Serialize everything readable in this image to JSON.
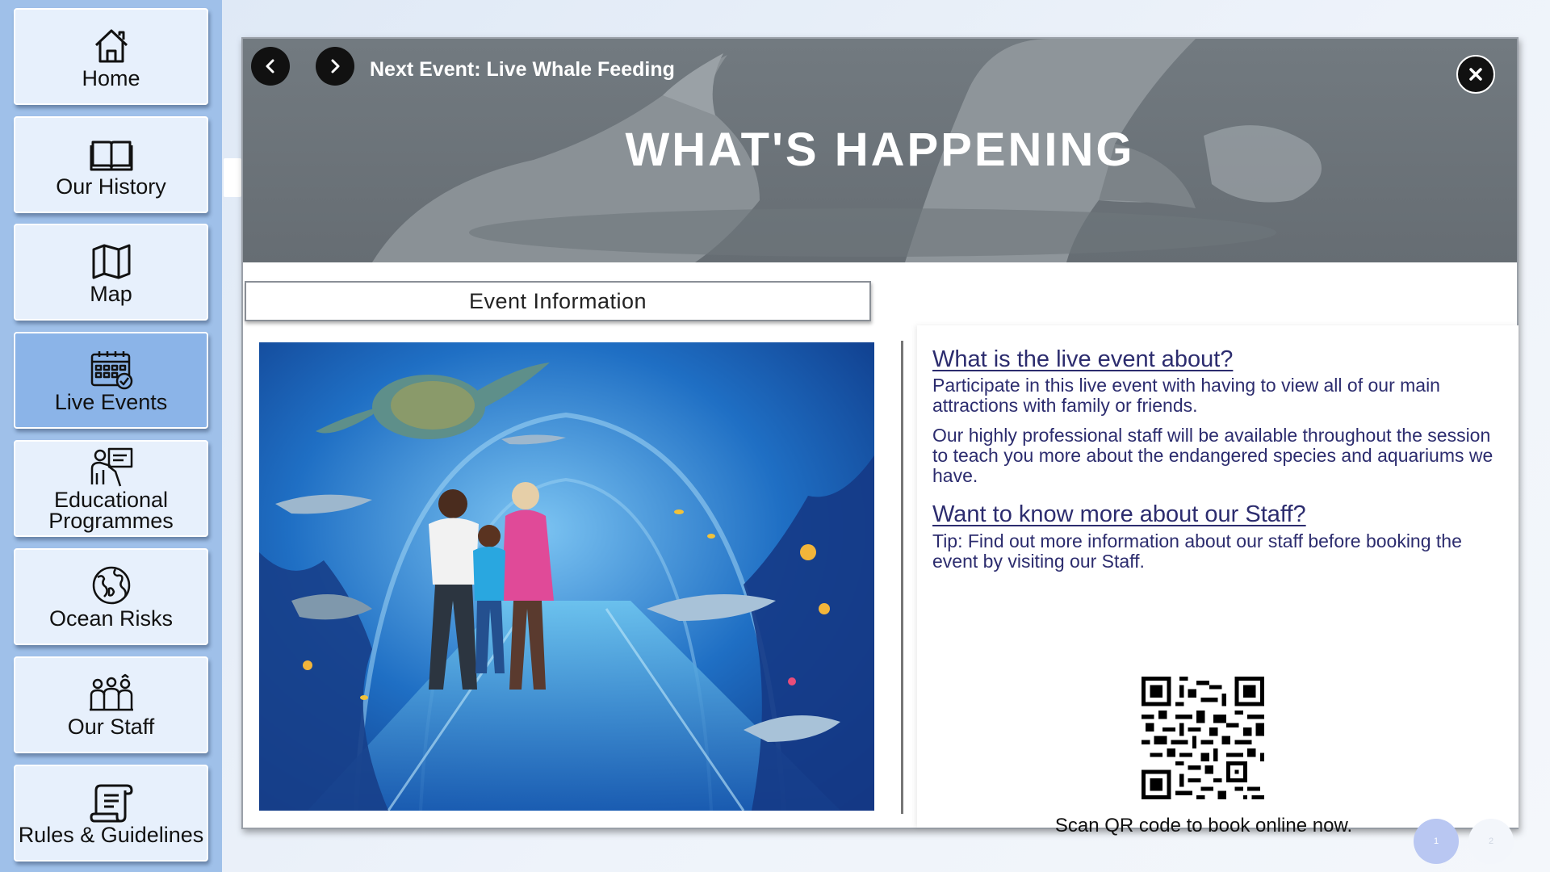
{
  "sidebar": {
    "items": [
      {
        "label": "Home",
        "icon": "home-icon"
      },
      {
        "label": "Our History",
        "icon": "book-icon"
      },
      {
        "label": "Map",
        "icon": "map-icon"
      },
      {
        "label": "Live Events",
        "icon": "calendar-check-icon",
        "active": true
      },
      {
        "label": "Educational Programmes",
        "icon": "teacher-board-icon"
      },
      {
        "label": "Ocean Risks",
        "icon": "globe-icon"
      },
      {
        "label": "Our Staff",
        "icon": "staff-group-icon"
      },
      {
        "label": "Rules & Guidelines",
        "icon": "scroll-icon"
      }
    ]
  },
  "banner": {
    "next_event": "Next Event: Live Whale Feeding",
    "title": "WHAT'S HAPPENING"
  },
  "tab": {
    "label": "Event Information"
  },
  "info": {
    "q1": "What is the live event about?",
    "p1": "Participate in this live event with having to view all of our main attractions with family or friends.",
    "p2": "Our highly professional staff will be available throughout the session to teach you more about the endangered species and aquariums we have.",
    "q2": "Want to know more about our Staff?",
    "p3": "Tip: Find out more information about our staff before booking the event by visiting our Staff.",
    "scan": "Scan QR code to book online now."
  },
  "pager": {
    "pages": [
      "1",
      "2"
    ],
    "active": "1"
  },
  "colors": {
    "sidebar_bg": "#9fc0e9",
    "nav_item_bg": "#e7f0fc",
    "nav_active_bg": "#8bb4e8",
    "heading_text": "#2c2c6e",
    "pager_active": "#b9c7f2"
  }
}
